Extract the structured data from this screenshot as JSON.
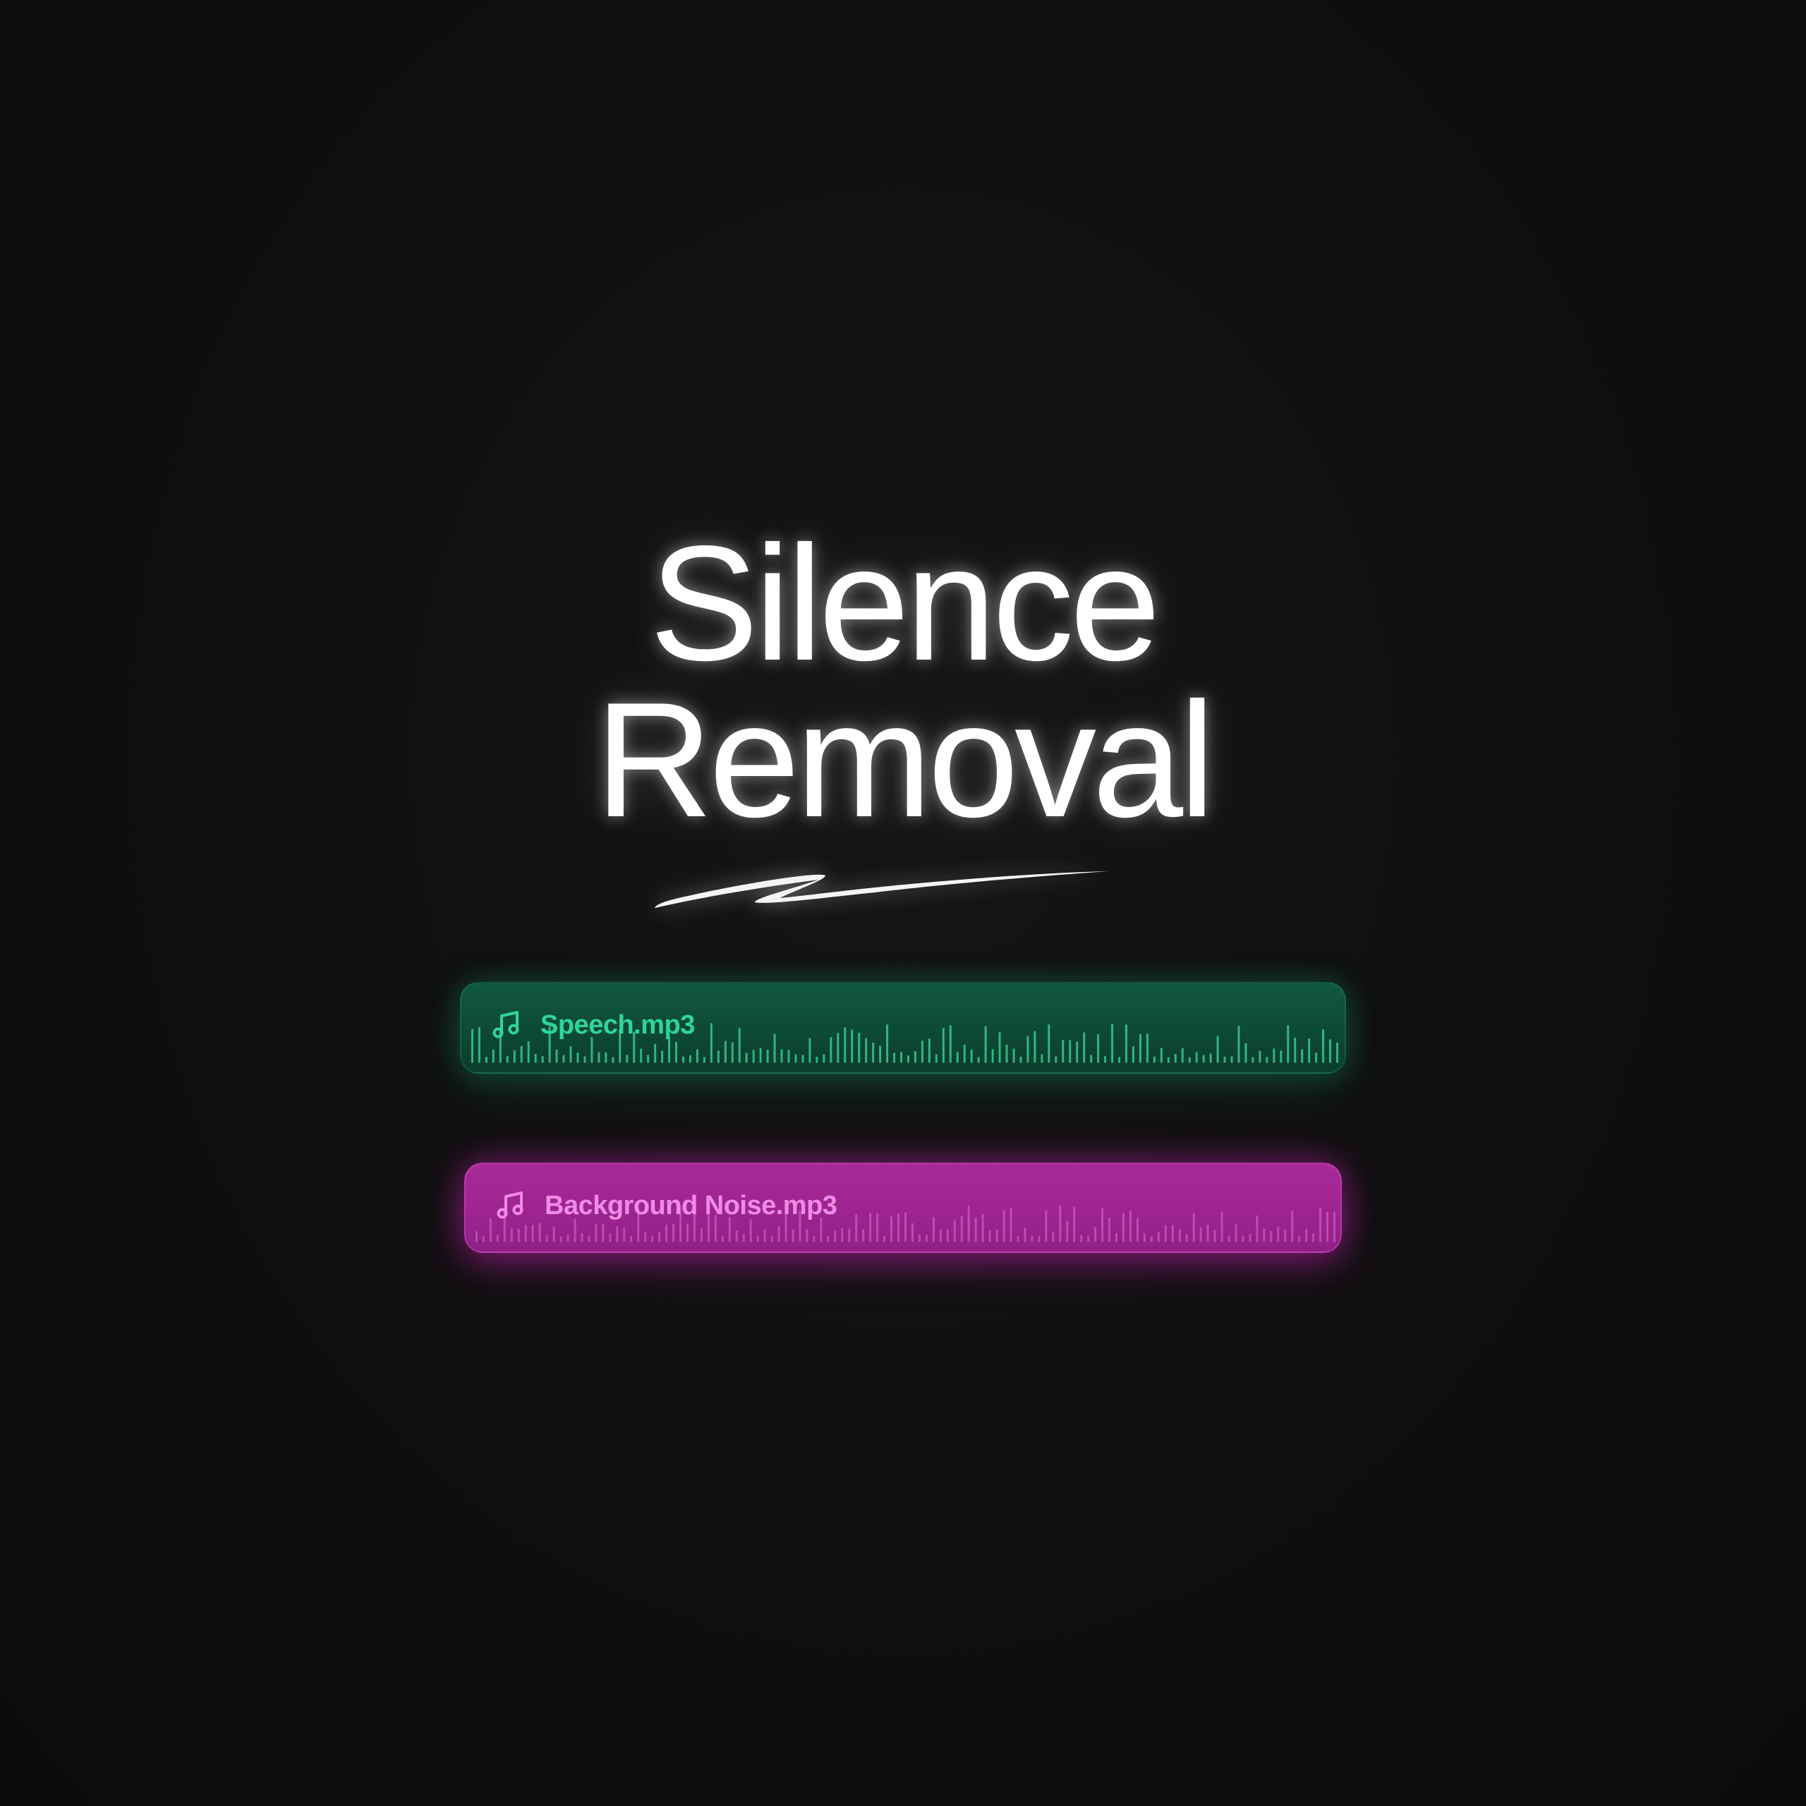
{
  "headline": {
    "line1": "Silence",
    "line2": "Removal"
  },
  "tracks": [
    {
      "id": "speech",
      "label": "Speech.mp3",
      "icon": "music-note-icon",
      "color": "#2fd59a",
      "background": "#0d4a34"
    },
    {
      "id": "noise",
      "label": "Background Noise.mp3",
      "icon": "music-note-icon",
      "color": "#f08be4",
      "background": "#9c2490"
    }
  ]
}
